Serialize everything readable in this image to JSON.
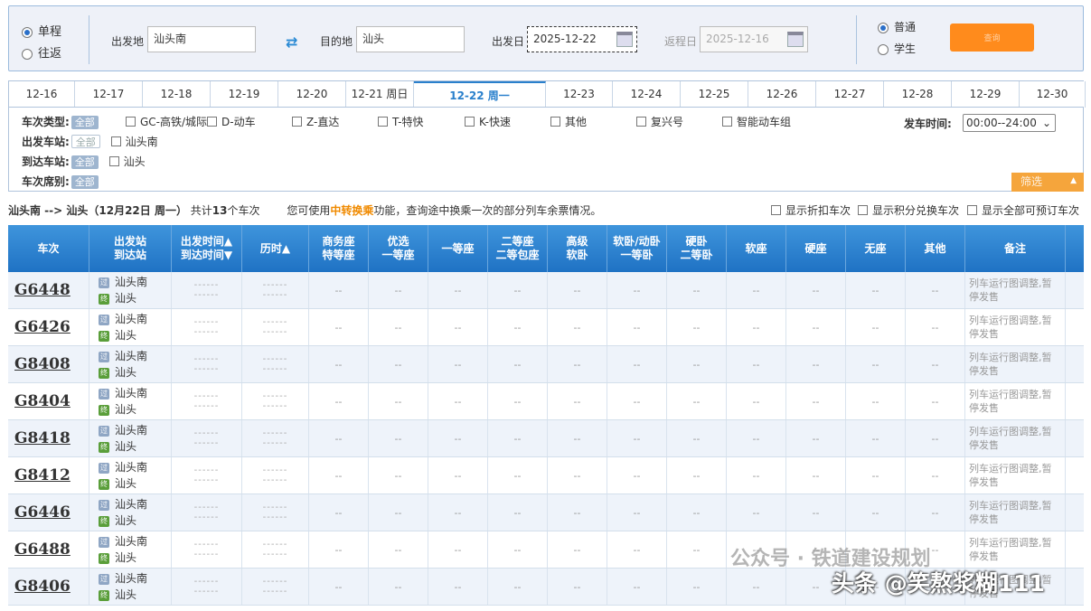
{
  "search": {
    "trip_one_way": "单程",
    "trip_round": "往返",
    "from_label": "出发地",
    "from_value": "汕头南",
    "to_label": "目的地",
    "to_value": "汕头",
    "depart_label": "出发日",
    "depart_value": "2025-12-22",
    "return_label": "返程日",
    "return_value": "2025-12-16",
    "type_normal": "普通",
    "type_student": "学生",
    "query_label": "查询",
    "swap_icon": "⇄"
  },
  "date_tabs": [
    "12-16",
    "12-17",
    "12-18",
    "12-19",
    "12-20",
    "12-21 周日",
    "12-22 周一",
    "12-23",
    "12-24",
    "12-25",
    "12-26",
    "12-27",
    "12-28",
    "12-29",
    "12-30"
  ],
  "filters": {
    "type_label": "车次类型:",
    "all": "全部",
    "types": [
      "GC-高铁/城际",
      "D-动车",
      "Z-直达",
      "T-特快",
      "K-快速",
      "其他",
      "复兴号",
      "智能动车组"
    ],
    "depart_station_label": "出发车站:",
    "depart_station": "汕头南",
    "arrive_station_label": "到达车站:",
    "arrive_station": "汕头",
    "route_label": "车次席别:",
    "time_label": "发车时间:",
    "time_value": "00:00--24:00",
    "filter_btn": "筛选"
  },
  "summary": {
    "route": "汕头南 --> 汕头（12月22日  周一）",
    "count_pre": "共计",
    "count": "13",
    "count_post": "个车次",
    "tip_pre": "您可使用",
    "tip_link": "中转换乘",
    "tip_post": "功能，查询途中换乘一次的部分列车余票情况。",
    "opt1": "显示折扣车次",
    "opt2": "显示积分兑换车次",
    "opt3": "显示全部可预订车次"
  },
  "headers": {
    "train": "车次",
    "st1": "出发站",
    "st2": "到达站",
    "t1": "出发时间▲",
    "t2": "到达时间▼",
    "dur": "历时▲",
    "biz1": "商务座",
    "biz2": "特等座",
    "pf1": "优选",
    "pf2": "一等座",
    "first": "一等座",
    "sec1": "二等座",
    "sec2": "二等包座",
    "hs1": "高级",
    "hs2": "软卧",
    "sl1": "软卧/动卧",
    "sl2": "一等卧",
    "hl1": "硬卧",
    "hl2": "二等卧",
    "ss": "软座",
    "hseat": "硬座",
    "none": "无座",
    "other": "其他",
    "note": "备注"
  },
  "pass_icon": "过",
  "end_icon": "终",
  "empty_time": "------",
  "empty_seat": "--",
  "note_text": "列车运行图调整,暂停发售",
  "trains": [
    {
      "no": "G6448",
      "from": "汕头南",
      "to": "汕头"
    },
    {
      "no": "G6426",
      "from": "汕头南",
      "to": "汕头"
    },
    {
      "no": "G8408",
      "from": "汕头南",
      "to": "汕头"
    },
    {
      "no": "G8404",
      "from": "汕头南",
      "to": "汕头"
    },
    {
      "no": "G8418",
      "from": "汕头南",
      "to": "汕头"
    },
    {
      "no": "G8412",
      "from": "汕头南",
      "to": "汕头"
    },
    {
      "no": "G6446",
      "from": "汕头南",
      "to": "汕头"
    },
    {
      "no": "G6488",
      "from": "汕头南",
      "to": "汕头"
    },
    {
      "no": "G8406",
      "from": "汕头南",
      "to": "汕头"
    }
  ],
  "watermark1": "公众号 · 铁道建设规划",
  "watermark2": "头条 @笑熬浆糊111",
  "colors": {
    "accent": "#2a80cc",
    "header": "#2f82cf",
    "orange": "#ff8b1c"
  }
}
